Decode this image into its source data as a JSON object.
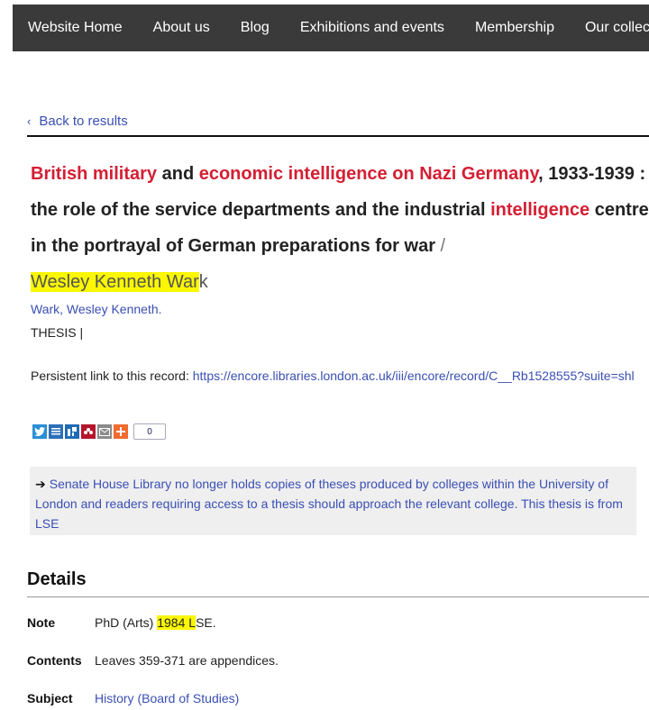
{
  "nav": {
    "items": [
      "Website Home",
      "About us",
      "Blog",
      "Exhibitions and events",
      "Membership",
      "Our collectio"
    ]
  },
  "back_link": {
    "icon": "chevron-left-icon",
    "label": "Back to results"
  },
  "record": {
    "title_parts": {
      "p1": "British military",
      "p2": " and ",
      "p3": "economic intelligence on Nazi Germany",
      "p4": ", 1933-1939 : the role of the service departments and the industrial ",
      "p5": "intelligence",
      "p6": " centre in the portrayal of German preparations for war",
      "slash": " / ",
      "author_highlight": "Wesley Kenneth War",
      "author_rest": "k"
    },
    "author_link": "Wark, Wesley Kenneth.",
    "format": "THESIS  |",
    "persistent_label": "Persistent link to this record: ",
    "persistent_url": "https://encore.libraries.london.ac.uk/iii/encore/record/C__Rb1528555?suite=shl"
  },
  "share": {
    "icons": [
      "twitter-icon",
      "print-icon",
      "delicious-icon",
      "mendeley-icon",
      "email-icon",
      "share-plus-icon"
    ],
    "count": "0"
  },
  "notice": {
    "arrow": "➔",
    "text": "Senate House Library no longer holds copies of theses produced by colleges within the University of London and readers requiring access to a thesis should approach the relevant college. This thesis is from LSE"
  },
  "details": {
    "heading": "Details",
    "note_label": "Note",
    "note_pre": "PhD (Arts) ",
    "note_highlight": "1984 L",
    "note_post": "SE.",
    "contents_label": "Contents",
    "contents_value": "Leaves 359-371 are appendices.",
    "subject_label": "Subject",
    "subject_value": "History (Board of Studies)"
  },
  "colors": {
    "nav_bg": "#3a3a3a",
    "link": "#3a4fb4",
    "keyword_red": "#d41f33",
    "highlight": "#fbf700"
  }
}
